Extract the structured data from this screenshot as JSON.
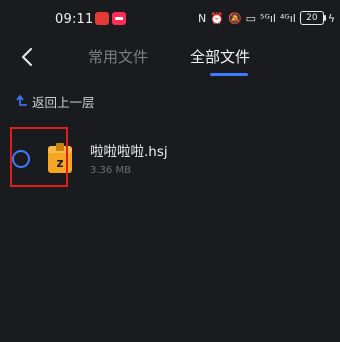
{
  "status": {
    "time": "09:11",
    "signal1": "⁵ᴳıl",
    "signal2": "⁴ᴳıl",
    "battery": "20"
  },
  "header": {
    "tabs": [
      {
        "label": "常用文件",
        "active": false
      },
      {
        "label": "全部文件",
        "active": true
      }
    ],
    "accent_color": "#3d7bff"
  },
  "nav": {
    "up_label": "返回上一层"
  },
  "files": [
    {
      "name": "啦啦啦啦.hsj",
      "size": "3.36 MB",
      "icon": "zip-file-icon",
      "selected": false
    }
  ],
  "highlight_color": "#e01e1e"
}
